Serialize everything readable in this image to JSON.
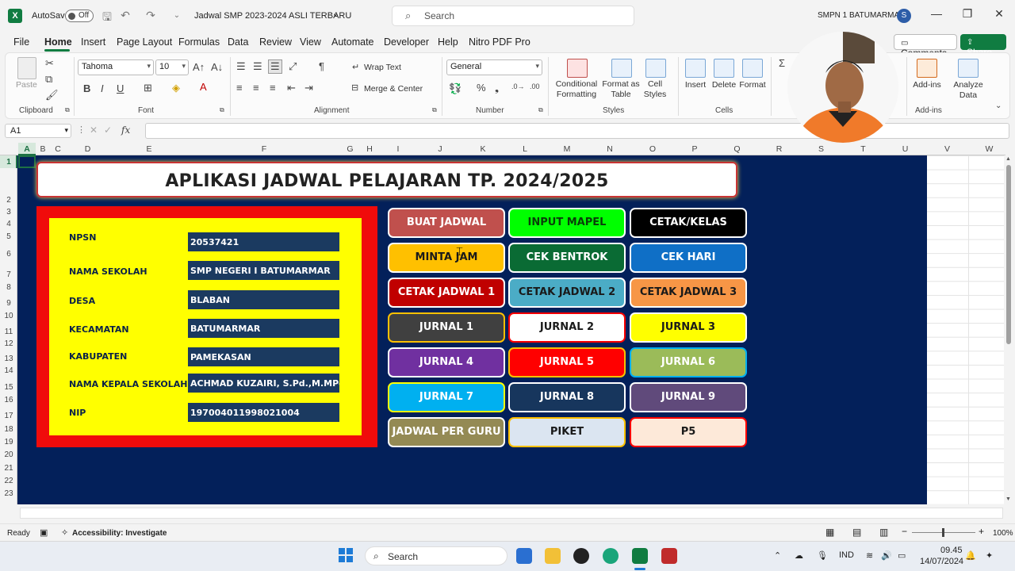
{
  "window": {
    "autosave_label": "AutoSave",
    "autosave_state": "Off",
    "file_title": "Jadwal SMP 2023-2024 ASLI TERBARU",
    "search_placeholder": "Search",
    "account_name": "SMPN 1 BATUMARMAR",
    "account_initial": "S"
  },
  "menu": {
    "tabs": [
      "File",
      "Home",
      "Insert",
      "Page Layout",
      "Formulas",
      "Data",
      "Review",
      "View",
      "Automate",
      "Developer",
      "Help",
      "Nitro PDF Pro"
    ],
    "comments_label": "Comments",
    "share_label": "Share"
  },
  "ribbon": {
    "clipboard": {
      "paste": "Paste",
      "label": "Clipboard"
    },
    "font": {
      "name": "Tahoma",
      "size": "10",
      "label": "Font"
    },
    "alignment": {
      "wrap": "Wrap Text",
      "merge": "Merge & Center",
      "label": "Alignment"
    },
    "number": {
      "format": "General",
      "label": "Number"
    },
    "styles": {
      "conditional": "Conditional Formatting",
      "format_table": "Format as Table",
      "cell_styles": "Cell Styles",
      "label": "Styles"
    },
    "cells": {
      "insert": "Insert",
      "delete": "Delete",
      "format": "Format",
      "label": "Cells"
    },
    "addins": {
      "addins": "Add-ins",
      "analyze": "Analyze Data",
      "label": "Add-ins"
    }
  },
  "formula_bar": {
    "cell_ref": "A1",
    "fx": "fx",
    "value": ""
  },
  "columns": [
    "A",
    "B",
    "C",
    "D",
    "E",
    "F",
    "G",
    "H",
    "I",
    "J",
    "K",
    "L",
    "M",
    "N",
    "O",
    "P",
    "Q",
    "R",
    "S",
    "T",
    "U",
    "V",
    "W"
  ],
  "rows": [
    "1",
    "2",
    "3",
    "4",
    "5",
    "6",
    "7",
    "8",
    "9",
    "10",
    "11",
    "12",
    "13",
    "14",
    "15",
    "16",
    "17",
    "18",
    "19",
    "20",
    "21",
    "22",
    "23"
  ],
  "sheet": {
    "title": "APLIKASI JADWAL PELAJARAN TP. 2024/2025",
    "info": [
      {
        "label": "NPSN",
        "value": "20537421"
      },
      {
        "label": "NAMA SEKOLAH",
        "value": "SMP NEGERI I BATUMARMAR"
      },
      {
        "label": "DESA",
        "value": "BLABAN"
      },
      {
        "label": "KECAMATAN",
        "value": "BATUMARMAR"
      },
      {
        "label": "KABUPATEN",
        "value": "PAMEKASAN"
      },
      {
        "label": "NAMA KEPALA SEKOLAH",
        "value": "ACHMAD KUZAIRI, S.Pd.,M.MPd."
      },
      {
        "label": "NIP",
        "value": "197004011998021004"
      }
    ],
    "buttons": [
      {
        "label": "BUAT JADWAL",
        "bg": "#c0504d",
        "fg": "#ffffff",
        "border": "#ffffff"
      },
      {
        "label": "INPUT MAPEL",
        "bg": "#00ff00",
        "fg": "#0a3d0a",
        "border": "#ffffff"
      },
      {
        "label": "CETAK/KELAS",
        "bg": "#000000",
        "fg": "#ffffff",
        "border": "#ffffff"
      },
      {
        "label": "MINTA JAM",
        "bg": "#ffc000",
        "fg": "#1a1a1a",
        "border": "#ffffff"
      },
      {
        "label": "CEK BENTROK",
        "bg": "#0a6b34",
        "fg": "#ffffff",
        "border": "#ffffff"
      },
      {
        "label": "CEK HARI",
        "bg": "#0f6fc6",
        "fg": "#ffffff",
        "border": "#ffffff"
      },
      {
        "label": "CETAK JADWAL 1",
        "bg": "#c00000",
        "fg": "#ffffff",
        "border": "#ffffff"
      },
      {
        "label": "CETAK JADWAL 2",
        "bg": "#4bacc6",
        "fg": "#1a1a1a",
        "border": "#ffffff"
      },
      {
        "label": "CETAK JADWAL 3",
        "bg": "#f79646",
        "fg": "#1a1a1a",
        "border": "#ffffff"
      },
      {
        "label": "JURNAL 1",
        "bg": "#404040",
        "fg": "#ffffff",
        "border": "#ffc000"
      },
      {
        "label": "JURNAL 2",
        "bg": "#ffffff",
        "fg": "#1a1a1a",
        "border": "#ff0000"
      },
      {
        "label": "JURNAL 3",
        "bg": "#ffff00",
        "fg": "#1a1a1a",
        "border": "#ffffff"
      },
      {
        "label": "JURNAL 4",
        "bg": "#7030a0",
        "fg": "#ffffff",
        "border": "#ffffff"
      },
      {
        "label": "JURNAL 5",
        "bg": "#ff0000",
        "fg": "#ffffff",
        "border": "#ffc000"
      },
      {
        "label": "JURNAL 6",
        "bg": "#9bbb59",
        "fg": "#ffffff",
        "border": "#00b0f0"
      },
      {
        "label": "JURNAL 7",
        "bg": "#00b0f0",
        "fg": "#ffffff",
        "border": "#ffff00"
      },
      {
        "label": "JURNAL 8",
        "bg": "#17365d",
        "fg": "#ffffff",
        "border": "#ffffff"
      },
      {
        "label": "JURNAL 9",
        "bg": "#604a7b",
        "fg": "#ffffff",
        "border": "#ffffff"
      },
      {
        "label": "JADWAL PER GURU",
        "bg": "#948a54",
        "fg": "#ffffff",
        "border": "#ffffff"
      },
      {
        "label": "PIKET",
        "bg": "#dbe5f1",
        "fg": "#1a1a1a",
        "border": "#ffc000"
      },
      {
        "label": "P5",
        "bg": "#fde9d9",
        "fg": "#1a1a1a",
        "border": "#ff0000"
      }
    ]
  },
  "status": {
    "ready": "Ready",
    "accessibility": "Accessibility: Investigate",
    "zoom": "100%"
  },
  "taskbar": {
    "search": "Search",
    "lang": "IND",
    "time": "09.45",
    "date": "14/07/2024"
  },
  "colors": {
    "sheet_bg": "#03205a",
    "info_frame": "#f00b0b",
    "info_panel": "#ffff00",
    "excel_green": "#107c41"
  }
}
